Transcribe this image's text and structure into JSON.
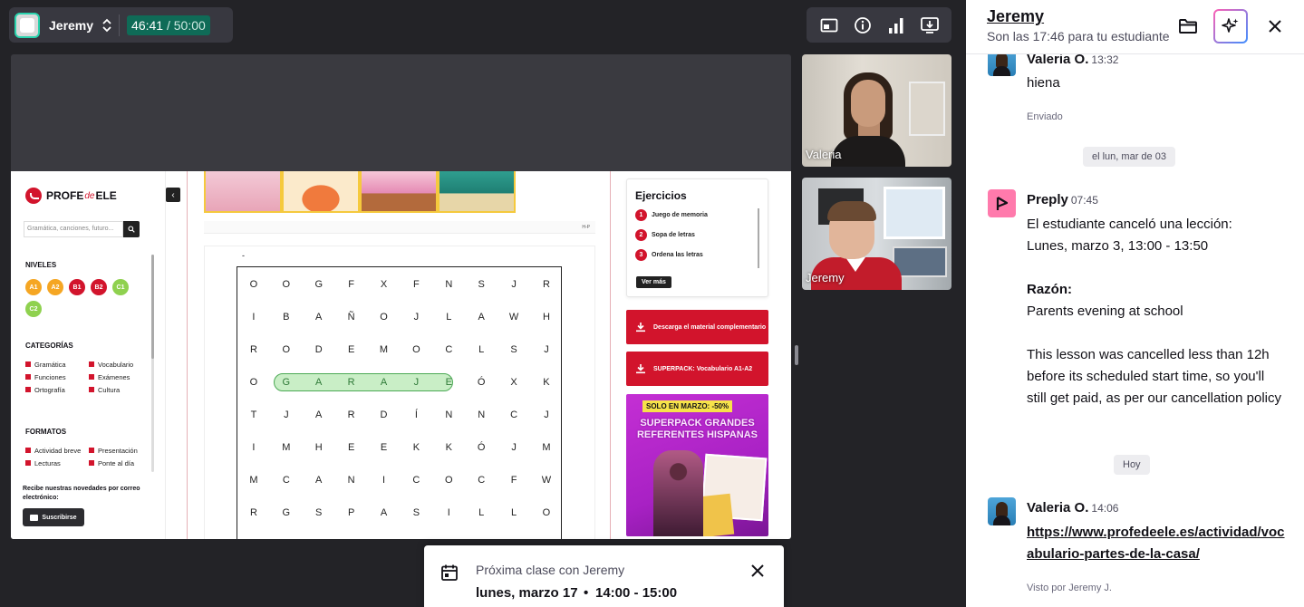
{
  "topbar": {
    "student_name": "Jeremy",
    "timer_elapsed": "46:41",
    "timer_total": " / 50:00"
  },
  "shared_page": {
    "logo_left": "PROFE",
    "logo_de": "de",
    "logo_right": "ELE",
    "search_placeholder": "Gramática, canciones, futuro...",
    "levels_title": "NIVELES",
    "levels": [
      {
        "label": "A1",
        "color": "#f5a623"
      },
      {
        "label": "A2",
        "color": "#f5a623"
      },
      {
        "label": "B1",
        "color": "#d2142c"
      },
      {
        "label": "B2",
        "color": "#d2142c"
      },
      {
        "label": "C1",
        "color": "#8fd14f"
      },
      {
        "label": "C2",
        "color": "#8fd14f"
      }
    ],
    "categories_title": "CATEGORÍAS",
    "categories": [
      "Gramática",
      "Vocabulario",
      "Funciones",
      "Exámenes",
      "Ortografía",
      "Cultura"
    ],
    "formats_title": "FORMATOS",
    "formats": [
      "Actividad breve",
      "Presentación",
      "Lecturas",
      "Ponte al día"
    ],
    "newsletter": "Recibe nuestras novedades por correo electrónico:",
    "subscribe_label": "Suscribirse",
    "thumb_caption": "H-P",
    "dash": "-",
    "word_grid": [
      [
        "O",
        "O",
        "G",
        "F",
        "X",
        "F",
        "N",
        "S",
        "J",
        "R"
      ],
      [
        "I",
        "B",
        "A",
        "Ñ",
        "O",
        "J",
        "L",
        "A",
        "W",
        "H"
      ],
      [
        "R",
        "O",
        "D",
        "E",
        "M",
        "O",
        "C",
        "L",
        "S",
        "J"
      ],
      [
        "O",
        "G",
        "A",
        "R",
        "A",
        "J",
        "E",
        "Ó",
        "X",
        "K"
      ],
      [
        "T",
        "J",
        "A",
        "R",
        "D",
        "Í",
        "N",
        "N",
        "C",
        "J"
      ],
      [
        "I",
        "M",
        "H",
        "E",
        "E",
        "K",
        "K",
        "Ó",
        "J",
        "M"
      ],
      [
        "M",
        "C",
        "A",
        "N",
        "I",
        "C",
        "O",
        "C",
        "F",
        "W"
      ],
      [
        "R",
        "G",
        "S",
        "P",
        "A",
        "S",
        "I",
        "L",
        "L",
        "O"
      ]
    ],
    "exercises_title": "Ejercicios",
    "exercises": [
      "Juego de memoria",
      "Sopa de letras",
      "Ordena las letras"
    ],
    "ver_mas": "Ver más",
    "download_1": "Descarga el material complementario",
    "download_2": "SUPERPACK: Vocabulario A1-A2",
    "promo_tag": "SOLO EN MARZO: -50%",
    "promo_title": "SUPERPACK GRANDES REFERENTES HISPANAS"
  },
  "videos": {
    "tutor_name": "Valeria",
    "student_name": "Jeremy"
  },
  "next_class": {
    "label": "Próxima clase con Jeremy",
    "date": "lunes, marzo 17",
    "dot": "•",
    "time": "14:00 - 15:00"
  },
  "chat": {
    "title": "Jeremy",
    "subtitle": "Son las 17:46 para tu estudiante",
    "messages": {
      "m1": {
        "sender": "Valeria O.",
        "time": "13:32",
        "text": "hiena",
        "status": "Enviado"
      },
      "day1": "el lun, mar de 03",
      "m2": {
        "sender": "Preply",
        "time": "07:45",
        "line1": "El estudiante canceló una lección:",
        "line2": "Lunes, marzo 3, 13:00 - 13:50",
        "reason_title": "Razón:",
        "reason": "Parents evening at school",
        "policy": "This lesson was cancelled less than 12h before its scheduled start time, so you'll still get paid, as per our cancellation policy"
      },
      "day2": "Hoy",
      "m3": {
        "sender": "Valeria O.",
        "time": "14:06",
        "link": "https://www.profedeele.es/actividad/vocabulario-partes-de-la-casa/",
        "status": "Visto por Jeremy J."
      }
    }
  }
}
